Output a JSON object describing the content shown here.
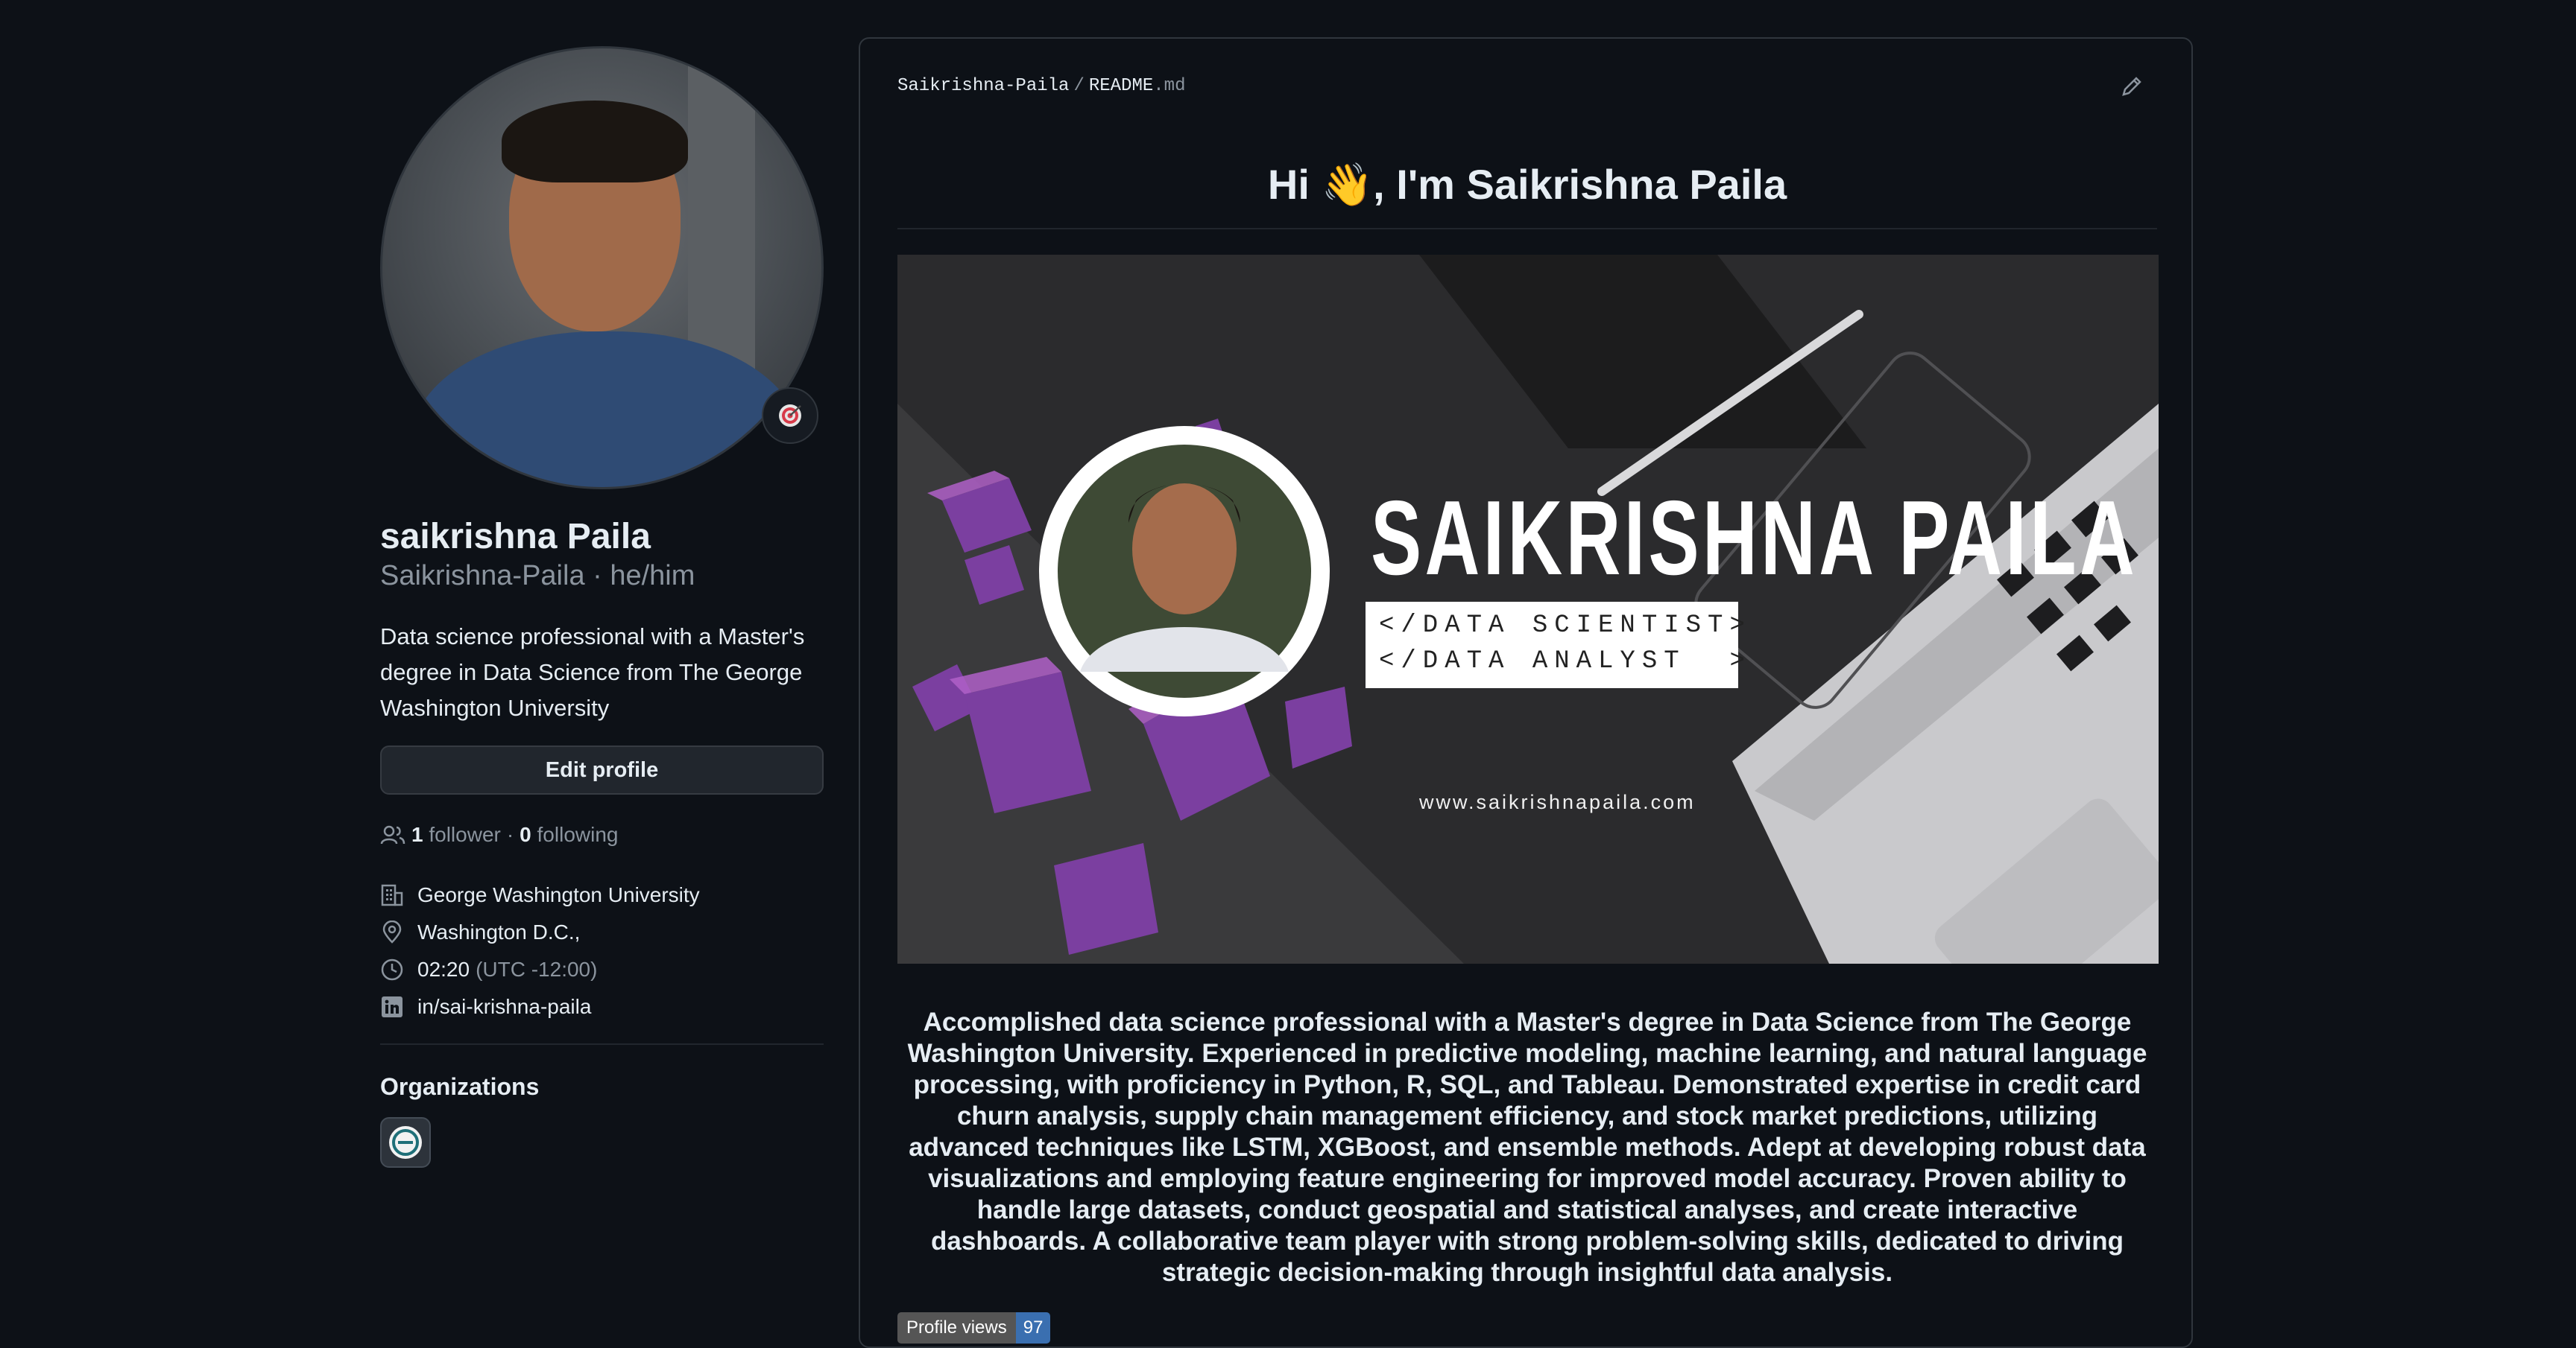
{
  "profile": {
    "display_name": "saikrishna Paila",
    "login_line": "Saikrishna-Paila · he/him",
    "bio": "Data science professional with a Master's degree in Data Science from The George Washington University",
    "edit_button": "Edit profile",
    "followers_count": "1",
    "followers_label": "follower",
    "following_separator": "·",
    "following_count": "0",
    "following_label": "following",
    "company": "George Washington University",
    "location": "Washington D.C.,",
    "local_time": "02:20",
    "timezone": "(UTC -12:00)",
    "linkedin": "in/sai-krishna-paila",
    "organizations_title": "Organizations"
  },
  "readme": {
    "crumb_owner": "Saikrishna-Paila",
    "crumb_sep": "/",
    "crumb_file": "README",
    "crumb_ext": ".md",
    "title": "Hi 👋, I'm Saikrishna Paila",
    "banner": {
      "name": "SAIKRISHNA PAILA",
      "roles": "</DATA SCIENTIST>\n</DATA ANALYST  >",
      "url": "www.saikrishnapaila.com"
    },
    "about": "Accomplished data science professional with a Master's degree in Data Science from The George Washington University. Experienced in predictive modeling, machine learning, and natural language processing, with proficiency in Python, R, SQL, and Tableau. Demonstrated expertise in credit card churn analysis, supply chain management efficiency, and stock market predictions, utilizing advanced techniques like LSTM, XGBoost, and ensemble methods. Adept at developing robust data visualizations and employing feature engineering for improved model accuracy. Proven ability to handle large datasets, conduct geospatial and statistical analyses, and create interactive dashboards. A collaborative team player with strong problem-solving skills, dedicated to driving strategic decision-making through insightful data analysis.",
    "views_label": "Profile views",
    "views_count": "97"
  },
  "icons": {
    "status": "target-emoji-icon",
    "followers": "people-icon",
    "company": "organization-icon",
    "location": "location-pin-icon",
    "time": "clock-icon",
    "linkedin": "linkedin-icon",
    "edit": "pencil-icon"
  },
  "colors": {
    "background": "#0d1117",
    "text": "#e6edf3",
    "muted": "#8b949e",
    "border": "#30363d",
    "views_badge": "#3a6fb0"
  }
}
